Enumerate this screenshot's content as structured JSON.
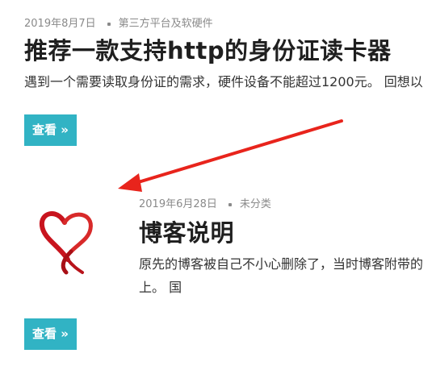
{
  "post1": {
    "date": "2019年8月7日",
    "category": "第三方平台及软硬件",
    "title": "推荐一款支持http的身份证读卡器",
    "excerpt": "遇到一个需要读取身份证的需求，硬件设备不能超过1200元。 回想以",
    "button_label": "查看 »"
  },
  "post2": {
    "date": "2019年6月28日",
    "category": "未分类",
    "title": "博客说明",
    "excerpt_line1": "原先的博客被自己不小心删除了，当时博客附带的",
    "excerpt_line2": "上。 国",
    "thumbnail_icon": "ribbon-heart-icon",
    "button_label": "查看 »"
  },
  "annotation": {
    "arrow_color": "#e8241c"
  },
  "colors": {
    "button": "#31b3c4",
    "meta": "#8a8a8a"
  }
}
